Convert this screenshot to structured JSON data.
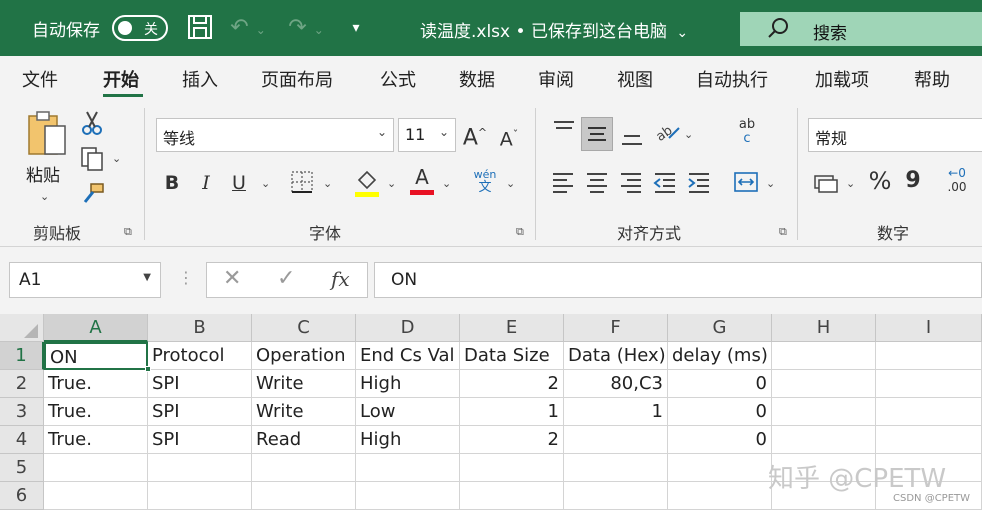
{
  "titlebar": {
    "autosave_label": "自动保存",
    "autosave_state": "关",
    "document_title": "读温度.xlsx • 已保存到这台电脑",
    "title_dropdown": "⌄",
    "search_label": "搜索"
  },
  "menu": {
    "tabs": [
      "文件",
      "开始",
      "插入",
      "页面布局",
      "公式",
      "数据",
      "审阅",
      "视图",
      "自动执行",
      "加载项",
      "帮助"
    ],
    "active": "开始"
  },
  "ribbon": {
    "clipboard": {
      "paste_label": "粘贴",
      "group_label": "剪贴板"
    },
    "font": {
      "font_name": "等线",
      "font_size": "11",
      "group_label": "字体",
      "bold": "B",
      "italic": "I",
      "underline": "U",
      "grow": "A",
      "shrink": "A",
      "font_color_glyph": "A",
      "wen_label": "wén",
      "wen_char": "文"
    },
    "alignment": {
      "group_label": "对齐方式",
      "wrap_label_top": "ab",
      "wrap_label_bottom": "c"
    },
    "number": {
      "format": "常规",
      "group_label": "数字",
      "percent": "%",
      "comma": "9",
      "decimal_label": ".00"
    }
  },
  "formula_bar": {
    "name_box": "A1",
    "formula": "ON",
    "fx_label": "fx"
  },
  "sheet": {
    "columns": [
      "A",
      "B",
      "C",
      "D",
      "E",
      "F",
      "G",
      "H",
      "I"
    ],
    "rows": [
      "1",
      "2",
      "3",
      "4",
      "5",
      "6"
    ],
    "cells": [
      [
        "ON",
        "Protocol",
        "Operation",
        "End Cs Val",
        "Data Size",
        "Data (Hex)",
        "delay (ms)",
        "",
        ""
      ],
      [
        "True.",
        "SPI",
        "Write",
        "High",
        "2",
        "80,C3",
        "0",
        "",
        ""
      ],
      [
        "True.",
        "SPI",
        "Write",
        "Low",
        "1",
        "1",
        "0",
        "",
        ""
      ],
      [
        "True.",
        "SPI",
        "Read",
        "High",
        "2",
        "",
        "0",
        "",
        ""
      ],
      [
        "",
        "",
        "",
        "",
        "",
        "",
        "",
        "",
        ""
      ],
      [
        "",
        "",
        "",
        "",
        "",
        "",
        "",
        "",
        ""
      ]
    ],
    "active_cell": "A1"
  },
  "watermark": {
    "main": "知乎 @CPETW",
    "small": "CSDN @CPETW"
  },
  "colors": {
    "accent": "#217346",
    "search_bg": "#9fd5b7"
  }
}
